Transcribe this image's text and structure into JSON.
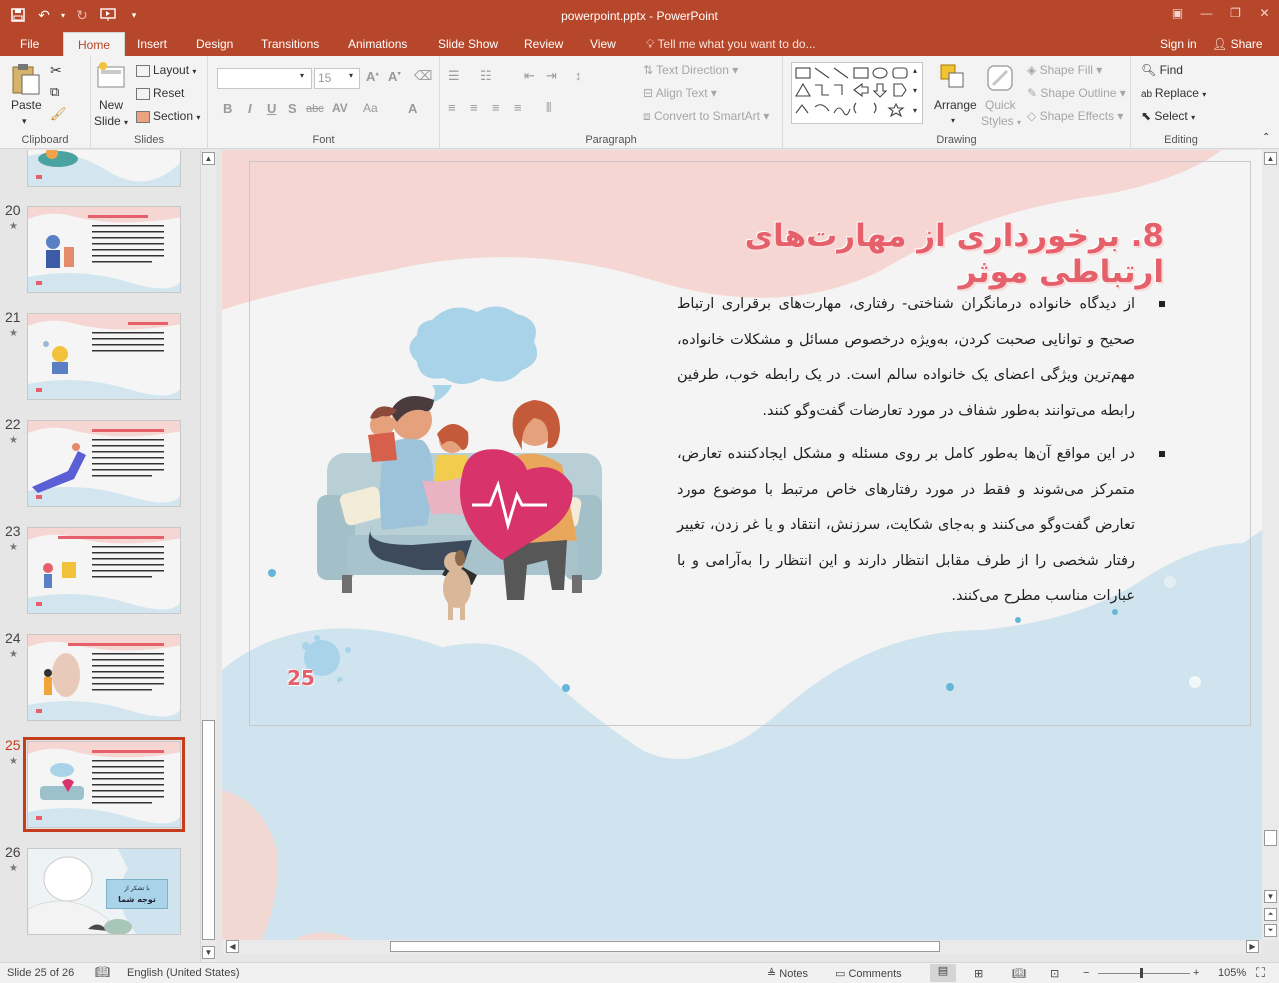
{
  "window": {
    "title": "powerpoint.pptx - PowerPoint",
    "minimize_icon": "minimize-icon",
    "maximize_icon": "restore-icon",
    "close_icon": "close-icon"
  },
  "quick_access": [
    "save-icon",
    "undo-icon",
    "redo-icon",
    "start-from-beginning-icon",
    "customize-icon"
  ],
  "tabs": [
    "File",
    "Home",
    "Insert",
    "Design",
    "Transitions",
    "Animations",
    "Slide Show",
    "Review",
    "View"
  ],
  "active_tab": "Home",
  "tell_me": "Tell me what you want to do...",
  "sign_in": "Sign in",
  "share": "Share",
  "ribbon": {
    "clipboard": {
      "label": "Clipboard",
      "paste": "Paste"
    },
    "slides": {
      "label": "Slides",
      "new_slide": "New",
      "new_slide2": "Slide",
      "layout": "Layout",
      "reset": "Reset",
      "section": "Section"
    },
    "font": {
      "label": "Font",
      "font_name": "",
      "font_size": "15",
      "bold": "B",
      "italic": "I",
      "underline": "U",
      "strike": "S",
      "shadow": "abc",
      "spacing": "AV",
      "case": "Aa",
      "color": "A"
    },
    "paragraph": {
      "label": "Paragraph",
      "text_direction": "Text Direction",
      "align_text": "Align Text",
      "smartart": "Convert to SmartArt"
    },
    "drawing": {
      "label": "Drawing",
      "arrange": "Arrange",
      "quick_styles": "Quick",
      "quick_styles2": "Styles",
      "shape_fill": "Shape Fill",
      "shape_outline": "Shape Outline",
      "shape_effects": "Shape Effects"
    },
    "editing": {
      "label": "Editing",
      "find": "Find",
      "replace": "Replace",
      "select": "Select"
    }
  },
  "thumbnails": [
    {
      "num": "20"
    },
    {
      "num": "21"
    },
    {
      "num": "22"
    },
    {
      "num": "23"
    },
    {
      "num": "24"
    },
    {
      "num": "25"
    },
    {
      "num": "26"
    }
  ],
  "slide": {
    "title": "8. برخورداری از مهارت‌های ارتباطی موثر",
    "bullets": [
      "از دیدگاه خانواده درمانگران شناختی- رفتاری، مهارت‌های برقراری ارتباط صحیح و توانایی صحبت کردن، به‌ویژه درخصوص مسائل و مشکلات خانواده، مهم‌ترین ویژگی اعضای یک خانواده سالم است. در یک رابطه خوب، طرفین رابطه می‌توانند به‌طور شفاف در مورد تعارضات گفت‌وگو کنند.",
      "در این مواقع آن‌ها به‌طور کامل بر روی مسئله و مشکل ایجادکننده تعارض، متمرکز می‌شوند و فقط در مورد رفتارهای خاص مرتبط با موضوع مورد تعارض گفت‌وگو می‌کنند و به‌جای شکایت، سرزنش، انتقاد و یا غر زدن، تغییر رفتار شخصی را از طرف مقابل انتظار دارند و این انتظار را به‌آرامی و با عبارات مناسب مطرح می‌کنند."
    ],
    "page_number": "25",
    "thumb26_line1": "با تشکر از",
    "thumb26_line2": "توجه شما"
  },
  "status": {
    "slide_info": "Slide 25 of 26",
    "language": "English (United States)",
    "notes": "Notes",
    "comments": "Comments",
    "zoom": "105%"
  },
  "colors": {
    "accent": "#b7472a",
    "title": "#e5606a",
    "blob_pink": "#f6d6d3",
    "blob_blue": "#cfe4ee"
  }
}
